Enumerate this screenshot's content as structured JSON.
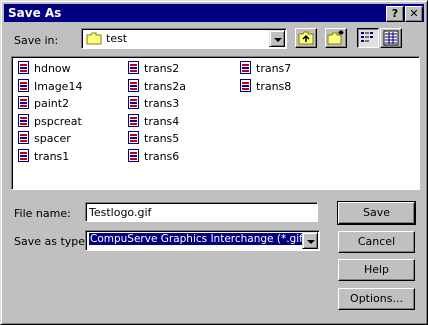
{
  "window": {
    "title": "Save As",
    "help_glyph": "?",
    "close_glyph": "✕"
  },
  "save_in": {
    "label": "Save in:",
    "value": "test"
  },
  "files": [
    {
      "name": "hdnow"
    },
    {
      "name": "Image14"
    },
    {
      "name": "paint2"
    },
    {
      "name": "pspcreat"
    },
    {
      "name": "spacer"
    },
    {
      "name": "trans1"
    },
    {
      "name": "trans2"
    },
    {
      "name": "trans2a"
    },
    {
      "name": "trans3"
    },
    {
      "name": "trans4"
    },
    {
      "name": "trans5"
    },
    {
      "name": "trans6"
    },
    {
      "name": "trans7"
    },
    {
      "name": "trans8"
    }
  ],
  "file_name": {
    "label": "File name:",
    "value": "Testlogo.gif"
  },
  "save_as_type": {
    "label": "Save as type:",
    "value": "CompuServe Graphics Interchange (*.gif)"
  },
  "buttons": {
    "save": "Save",
    "cancel": "Cancel",
    "help": "Help",
    "options": "Options..."
  },
  "colors": {
    "titlebar": "#000080",
    "face": "#c0c0c0"
  }
}
